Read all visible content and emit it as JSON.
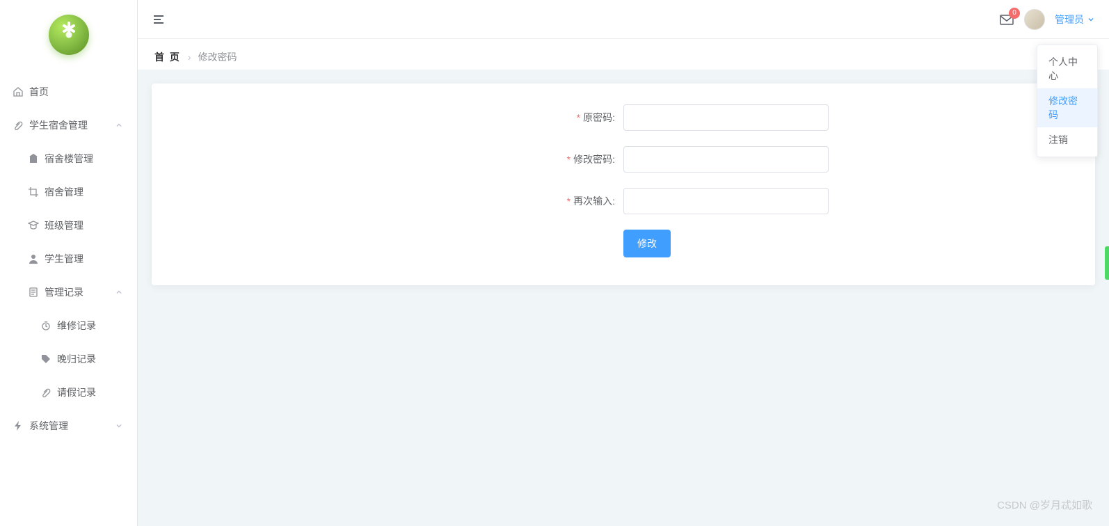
{
  "sidebar": {
    "items": [
      {
        "label": "首页"
      },
      {
        "label": "学生宿舍管理"
      },
      {
        "label": "宿舍楼管理"
      },
      {
        "label": "宿舍管理"
      },
      {
        "label": "班级管理"
      },
      {
        "label": "学生管理"
      },
      {
        "label": "管理记录"
      },
      {
        "label": "维修记录"
      },
      {
        "label": "晚归记录"
      },
      {
        "label": "请假记录"
      },
      {
        "label": "系统管理"
      }
    ]
  },
  "header": {
    "badge": "0",
    "username": "管理员"
  },
  "breadcrumb": {
    "home": "首 页",
    "current": "修改密码"
  },
  "form": {
    "old_pw_label": "原密码:",
    "new_pw_label": "修改密码:",
    "confirm_label": "再次输入:",
    "submit": "修改"
  },
  "dropdown": {
    "profile": "个人中心",
    "change_pw": "修改密码",
    "logout": "注销"
  },
  "watermark": "CSDN @岁月忒如歌"
}
